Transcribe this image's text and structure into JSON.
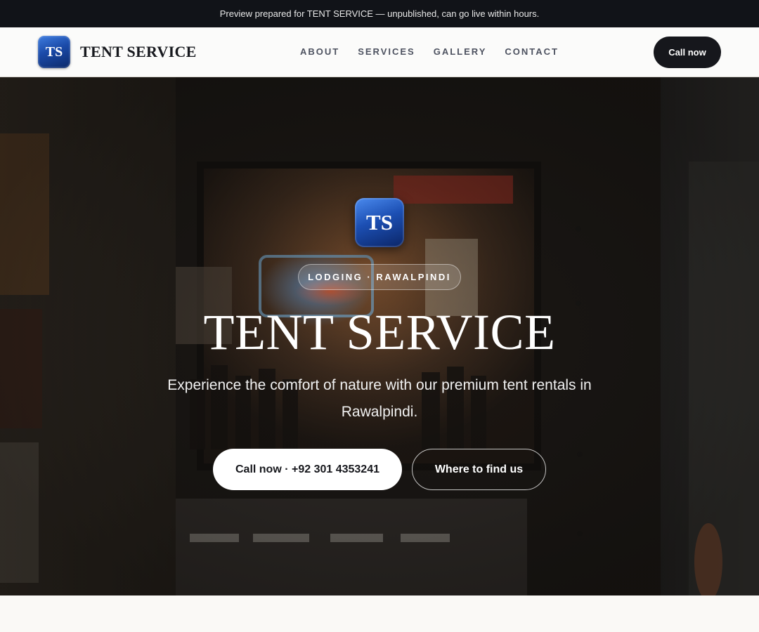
{
  "preview_banner": {
    "text": "Preview prepared for TENT SERVICE — unpublished, can go live within hours."
  },
  "nav": {
    "logo_monogram": "TS",
    "brand_name": "TENT SERVICE",
    "links": [
      {
        "label": "ABOUT"
      },
      {
        "label": "SERVICES"
      },
      {
        "label": "GALLERY"
      },
      {
        "label": "CONTACT"
      }
    ],
    "cta_label": "Call now"
  },
  "hero": {
    "logo_monogram": "TS",
    "category_badge": "LODGING · RAWALPINDI",
    "title": "TENT SERVICE",
    "subtitle": "Experience the comfort of nature with our premium tent rentals in Rawalpindi.",
    "primary_button": "Call now · +92 301 4353241",
    "secondary_button": "Where to find us",
    "background_image": "dim night street storefront with neon signs"
  },
  "colors": {
    "banner_bg": "#111318",
    "dark_button": "#16171c",
    "logo_blue": "#1c4fb3",
    "page_bg": "#faf9f6"
  }
}
